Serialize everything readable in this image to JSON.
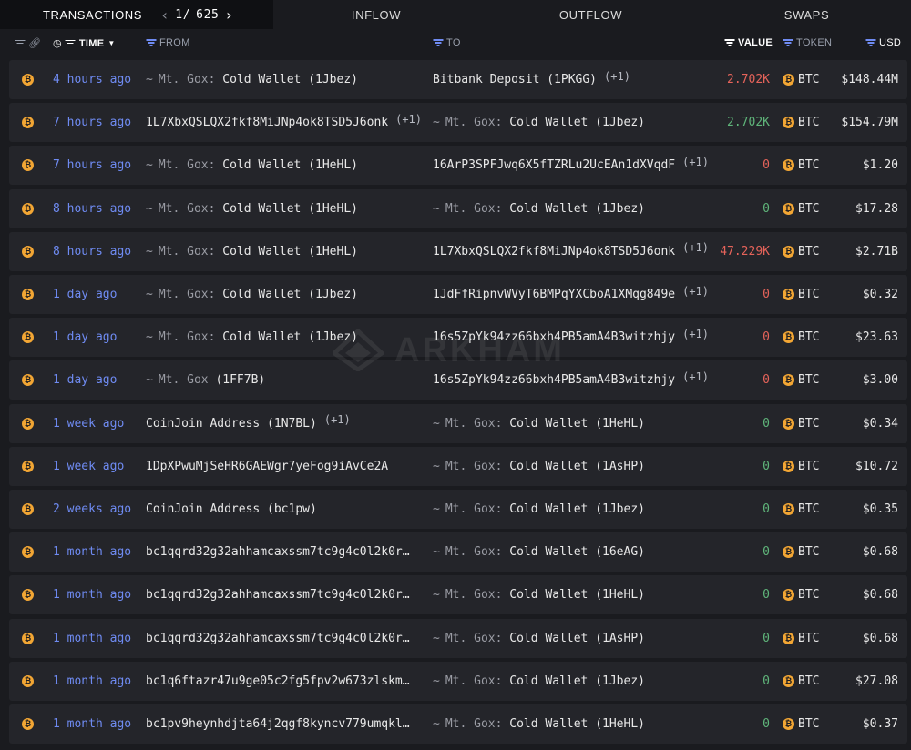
{
  "tabs": {
    "transactions": "TRANSACTIONS",
    "page_current": "1/",
    "page_total": "625",
    "inflow": "INFLOW",
    "outflow": "OUTFLOW",
    "swaps": "SWAPS"
  },
  "columns": {
    "time": "TIME",
    "from": "FROM",
    "to": "TO",
    "value": "VALUE",
    "token": "TOKEN",
    "usd": "USD"
  },
  "watermark": "ARKHAM",
  "rows": [
    {
      "time": "4 hours ago",
      "from_entity": "Mt. Gox:",
      "from_name": " Cold Wallet (1Jbez)",
      "from_extra": "",
      "to_entity": "",
      "to_name": "Bitbank Deposit (1PKGG)",
      "to_extra": "(+1)",
      "value": "2.702K",
      "token": "BTC",
      "usd": "$148.44M"
    },
    {
      "time": "7 hours ago",
      "from_entity": "",
      "from_name": "1L7XbxQSLQX2fkf8MiJNp4ok8TSD5J6onk",
      "from_extra": "(+1)",
      "to_entity": "Mt. Gox:",
      "to_name": " Cold Wallet (1Jbez)",
      "to_extra": "",
      "value": "2.702K",
      "token": "BTC",
      "usd": "$154.79M"
    },
    {
      "time": "7 hours ago",
      "from_entity": "Mt. Gox:",
      "from_name": " Cold Wallet (1HeHL)",
      "from_extra": "",
      "to_entity": "",
      "to_name": "16ArP3SPFJwq6X5fTZRLu2UcEAn1dXVqdF",
      "to_extra": "(+1)",
      "value": "0",
      "token": "BTC",
      "usd": "$1.20"
    },
    {
      "time": "8 hours ago",
      "from_entity": "Mt. Gox:",
      "from_name": " Cold Wallet (1HeHL)",
      "from_extra": "",
      "to_entity": "Mt. Gox:",
      "to_name": " Cold Wallet (1Jbez)",
      "to_extra": "",
      "value": "0",
      "token": "BTC",
      "usd": "$17.28"
    },
    {
      "time": "8 hours ago",
      "from_entity": "Mt. Gox:",
      "from_name": " Cold Wallet (1HeHL)",
      "from_extra": "",
      "to_entity": "",
      "to_name": "1L7XbxQSLQX2fkf8MiJNp4ok8TSD5J6onk",
      "to_extra": "(+1)",
      "value": "47.229K",
      "token": "BTC",
      "usd": "$2.71B"
    },
    {
      "time": "1 day ago",
      "from_entity": "Mt. Gox:",
      "from_name": " Cold Wallet (1Jbez)",
      "from_extra": "",
      "to_entity": "",
      "to_name": "1JdFfRipnvWVyT6BMPqYXCboA1XMqg849e",
      "to_extra": "(+1)",
      "value": "0",
      "token": "BTC",
      "usd": "$0.32"
    },
    {
      "time": "1 day ago",
      "from_entity": "Mt. Gox:",
      "from_name": " Cold Wallet (1Jbez)",
      "from_extra": "",
      "to_entity": "",
      "to_name": "16s5ZpYk94zz66bxh4PB5amA4B3witzhjy",
      "to_extra": "(+1)",
      "value": "0",
      "token": "BTC",
      "usd": "$23.63"
    },
    {
      "time": "1 day ago",
      "from_entity": "Mt. Gox",
      "from_name": " (1FF7B)",
      "from_extra": "",
      "to_entity": "",
      "to_name": "16s5ZpYk94zz66bxh4PB5amA4B3witzhjy",
      "to_extra": "(+1)",
      "value": "0",
      "token": "BTC",
      "usd": "$3.00"
    },
    {
      "time": "1 week ago",
      "from_entity": "",
      "from_name": "CoinJoin Address (1N7BL)",
      "from_extra": "(+1)",
      "to_entity": "Mt. Gox:",
      "to_name": " Cold Wallet (1HeHL)",
      "to_extra": "",
      "value": "0",
      "token": "BTC",
      "usd": "$0.34"
    },
    {
      "time": "1 week ago",
      "from_entity": "",
      "from_name": "1DpXPwuMjSeHR6GAEWgr7yeFog9iAvCe2A",
      "from_extra": "",
      "to_entity": "Mt. Gox:",
      "to_name": " Cold Wallet (1AsHP)",
      "to_extra": "",
      "value": "0",
      "token": "BTC",
      "usd": "$10.72"
    },
    {
      "time": "2 weeks ago",
      "from_entity": "",
      "from_name": "CoinJoin Address (bc1pw)",
      "from_extra": "",
      "to_entity": "Mt. Gox:",
      "to_name": " Cold Wallet (1Jbez)",
      "to_extra": "",
      "value": "0",
      "token": "BTC",
      "usd": "$0.35"
    },
    {
      "time": "1 month ago",
      "from_entity": "",
      "from_name": "bc1qqrd32g32ahhamcaxssm7tc9g4c0l2k0r…",
      "from_extra": "",
      "to_entity": "Mt. Gox:",
      "to_name": " Cold Wallet (16eAG)",
      "to_extra": "",
      "value": "0",
      "token": "BTC",
      "usd": "$0.68"
    },
    {
      "time": "1 month ago",
      "from_entity": "",
      "from_name": "bc1qqrd32g32ahhamcaxssm7tc9g4c0l2k0r…",
      "from_extra": "",
      "to_entity": "Mt. Gox:",
      "to_name": " Cold Wallet (1HeHL)",
      "to_extra": "",
      "value": "0",
      "token": "BTC",
      "usd": "$0.68"
    },
    {
      "time": "1 month ago",
      "from_entity": "",
      "from_name": "bc1qqrd32g32ahhamcaxssm7tc9g4c0l2k0r…",
      "from_extra": "",
      "to_entity": "Mt. Gox:",
      "to_name": " Cold Wallet (1AsHP)",
      "to_extra": "",
      "value": "0",
      "token": "BTC",
      "usd": "$0.68"
    },
    {
      "time": "1 month ago",
      "from_entity": "",
      "from_name": "bc1q6ftazr47u9ge05c2fg5fpv2w673zlskm…",
      "from_extra": "",
      "to_entity": "Mt. Gox:",
      "to_name": " Cold Wallet (1Jbez)",
      "to_extra": "",
      "value": "0",
      "token": "BTC",
      "usd": "$27.08"
    },
    {
      "time": "1 month ago",
      "from_entity": "",
      "from_name": "bc1pv9heynhdjta64j2qgf8kyncv779umqkl…",
      "from_extra": "",
      "to_entity": "Mt. Gox:",
      "to_name": " Cold Wallet (1HeHL)",
      "to_extra": "",
      "value": "0",
      "token": "BTC",
      "usd": "$0.37"
    }
  ],
  "value_colors": [
    "red",
    "green",
    "red",
    "green",
    "red",
    "red",
    "red",
    "red",
    "green",
    "green",
    "green",
    "green",
    "green",
    "green",
    "green",
    "green"
  ],
  "colors": {
    "link_blue": "#6f8bf2",
    "value_red": "#e5635a",
    "value_green": "#5fb57a",
    "btc_orange": "#f2a634",
    "row_bg": "#24252a",
    "page_bg": "#1a1b1f"
  },
  "icons": {
    "coin": "bitcoin-icon",
    "entity": "entity-wave-icon"
  }
}
